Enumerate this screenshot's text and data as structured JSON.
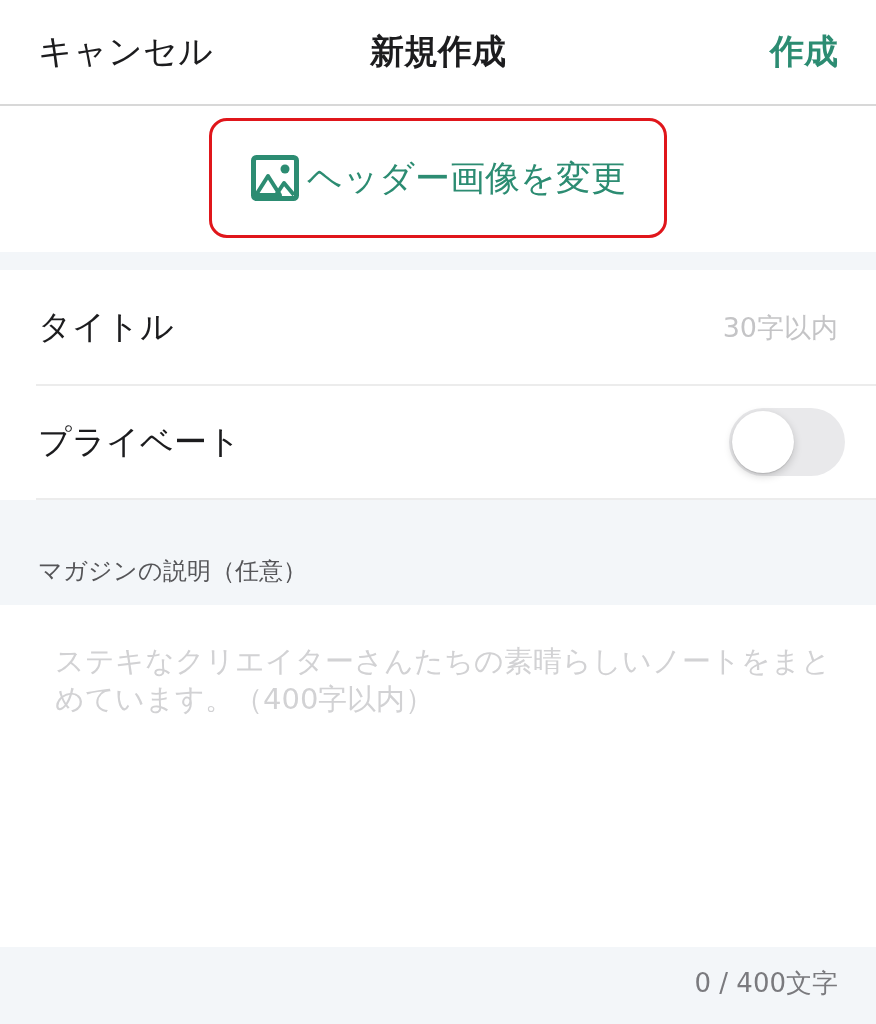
{
  "nav_bar": {
    "cancel": "キャンセル",
    "title": "新規作成",
    "create": "作成"
  },
  "header_image_button": {
    "label": "ヘッダー画像を変更",
    "highlighted": true
  },
  "rows": [
    {
      "kind": "text",
      "label": "タイトル",
      "placeholder": "30字以内"
    },
    {
      "kind": "toggle",
      "label": "プライベート",
      "on": false
    }
  ],
  "description": {
    "label": "マガジンの説明（任意）",
    "placeholder": "ステキなクリエイターさんたちの素晴らしいノートをまとめています。（400字以内）",
    "counter": "0 / 400文字"
  }
}
